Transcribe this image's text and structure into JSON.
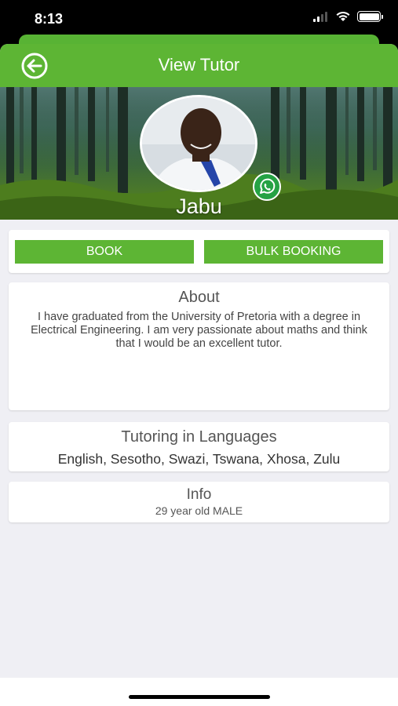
{
  "status_bar": {
    "time": "8:13",
    "icons": [
      "signal-icon",
      "wifi-icon",
      "battery-icon"
    ]
  },
  "nav": {
    "title": "View Tutor",
    "back_icon": "arrow-left-circle-icon"
  },
  "profile": {
    "name": "Jabu",
    "contact_icon": "whatsapp-icon",
    "favorite_icon": "heart-icon"
  },
  "actions": {
    "book_label": "BOOK",
    "bulk_label": "BULK BOOKING"
  },
  "about": {
    "heading": "About",
    "text": "I have graduated from the University of Pretoria with a degree in Electrical Engineering. I am very passionate about maths and think that I would be an excellent tutor."
  },
  "languages": {
    "heading": "Tutoring in Languages",
    "list": "English, Sesotho, Swazi, Tswana, Xhosa, Zulu"
  },
  "info": {
    "heading": "Info",
    "details": "29 year old MALE"
  },
  "colors": {
    "primary_green": "#5db534",
    "background": "#efeff4",
    "whatsapp": "#25a244"
  }
}
